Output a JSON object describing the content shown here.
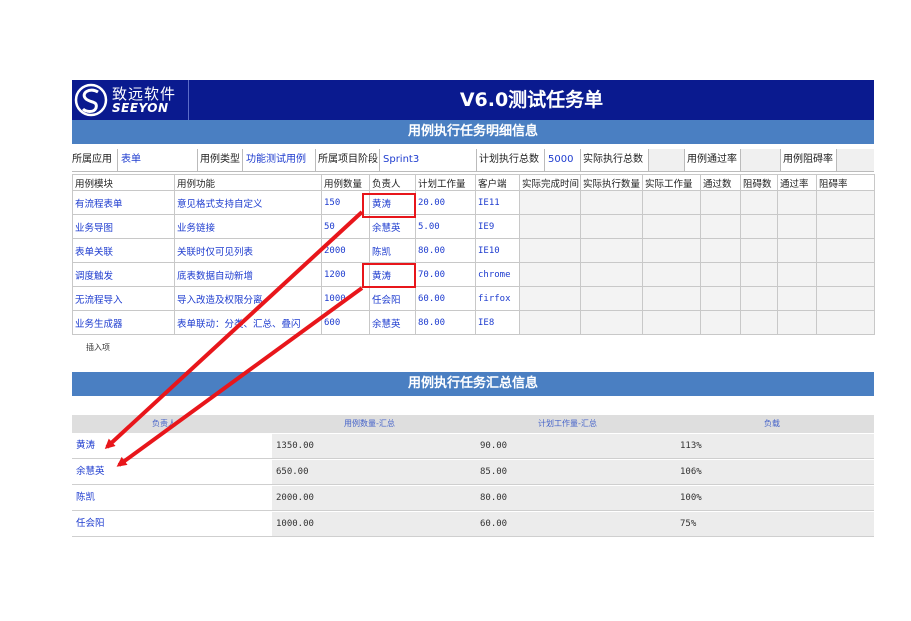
{
  "brand": {
    "name_cn": "致远软件",
    "name_en": "SEEYON"
  },
  "title": "V6.0测试任务单",
  "section_detail": "用例执行任务明细信息",
  "section_summary": "用例执行任务汇总信息",
  "info": {
    "app_label": "所属应用",
    "app_value": "表单",
    "type_label": "用例类型",
    "type_value": "功能测试用例",
    "stage_label": "所属项目阶段",
    "stage_value": "Sprint3",
    "plan_label": "计划执行总数",
    "plan_value": "5000",
    "actual_label": "实际执行总数",
    "pass_label": "用例通过率",
    "block_label": "用例阻碍率"
  },
  "detail_headers": [
    "用例模块",
    "用例功能",
    "用例数量",
    "负责人",
    "计划工作量",
    "客户端",
    "实际完成时间",
    "实际执行数量",
    "实际工作量",
    "通过数",
    "阻碍数",
    "通过率",
    "阻碍率"
  ],
  "detail_rows": [
    {
      "module": "有流程表单",
      "func": "意见格式支持自定义",
      "count": "150",
      "owner": "黄涛",
      "work": "20.00",
      "client": "IE11"
    },
    {
      "module": "业务导图",
      "func": "业务链接",
      "count": "50",
      "owner": "余慧英",
      "work": "5.00",
      "client": "IE9"
    },
    {
      "module": "表单关联",
      "func": "关联时仅可见列表",
      "count": "2000",
      "owner": "陈凯",
      "work": "80.00",
      "client": "IE10"
    },
    {
      "module": "调度触发",
      "func": "底表数据自动新增",
      "count": "1200",
      "owner": "黄涛",
      "work": "70.00",
      "client": "chrome"
    },
    {
      "module": "无流程导入",
      "func": "导入改造及权限分离",
      "count": "1000",
      "owner": "任会阳",
      "work": "60.00",
      "client": "firfox"
    },
    {
      "module": "业务生成器",
      "func": "表单联动：分类、汇总、叠闪",
      "count": "600",
      "owner": "余慧英",
      "work": "80.00",
      "client": "IE8"
    }
  ],
  "insert_link": "插入项",
  "summary_headers": [
    "负责人",
    "用例数量-汇总",
    "计划工作量-汇总",
    "负载"
  ],
  "summary_rows": [
    {
      "name": "黄涛",
      "count": "1350.00",
      "work": "90.00",
      "load": "113%"
    },
    {
      "name": "余慧英",
      "count": "650.00",
      "work": "85.00",
      "load": "106%"
    },
    {
      "name": "陈凯",
      "count": "2000.00",
      "work": "80.00",
      "load": "100%"
    },
    {
      "name": "任会阳",
      "count": "1000.00",
      "work": "60.00",
      "load": "75%"
    }
  ],
  "colors": {
    "header_bg": "#0a1a8f",
    "section_bg": "#4a7fc2",
    "highlight": "#e8161b",
    "value_text": "#1e3ccf"
  }
}
